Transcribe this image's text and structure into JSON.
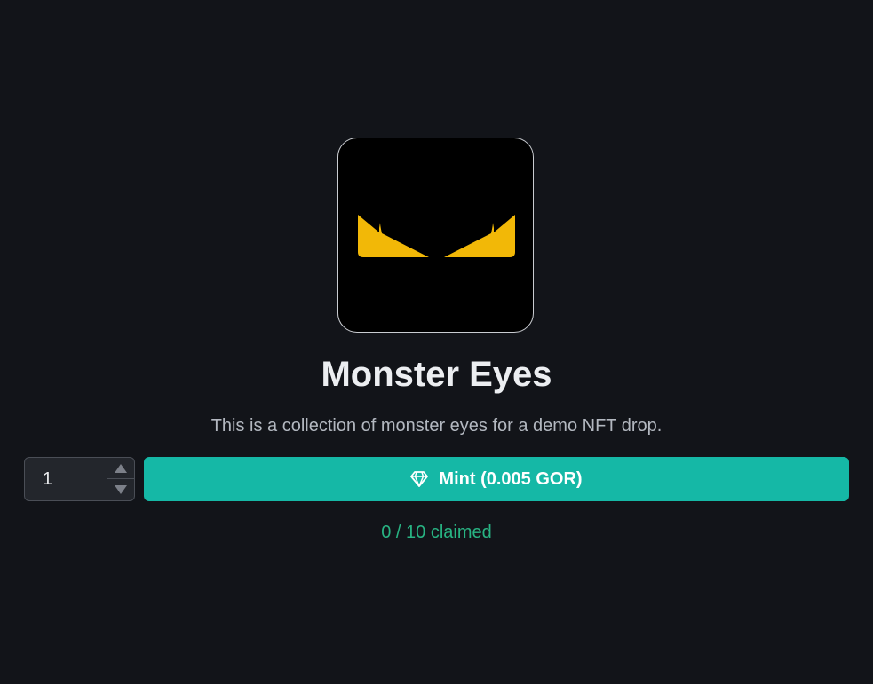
{
  "nft": {
    "image_icon": "monster-eyes-artwork",
    "title": "Monster Eyes",
    "description": "This is a collection of monster eyes for a demo NFT drop."
  },
  "mint": {
    "quantity": "1",
    "button_label": "Mint (0.005 GOR)",
    "button_icon": "diamond-icon"
  },
  "status": {
    "claimed_text": "0 / 10 claimed"
  },
  "colors": {
    "background": "#121419",
    "accent": "#15b8a6",
    "claimed": "#28b483",
    "eyes": "#f2b807"
  }
}
